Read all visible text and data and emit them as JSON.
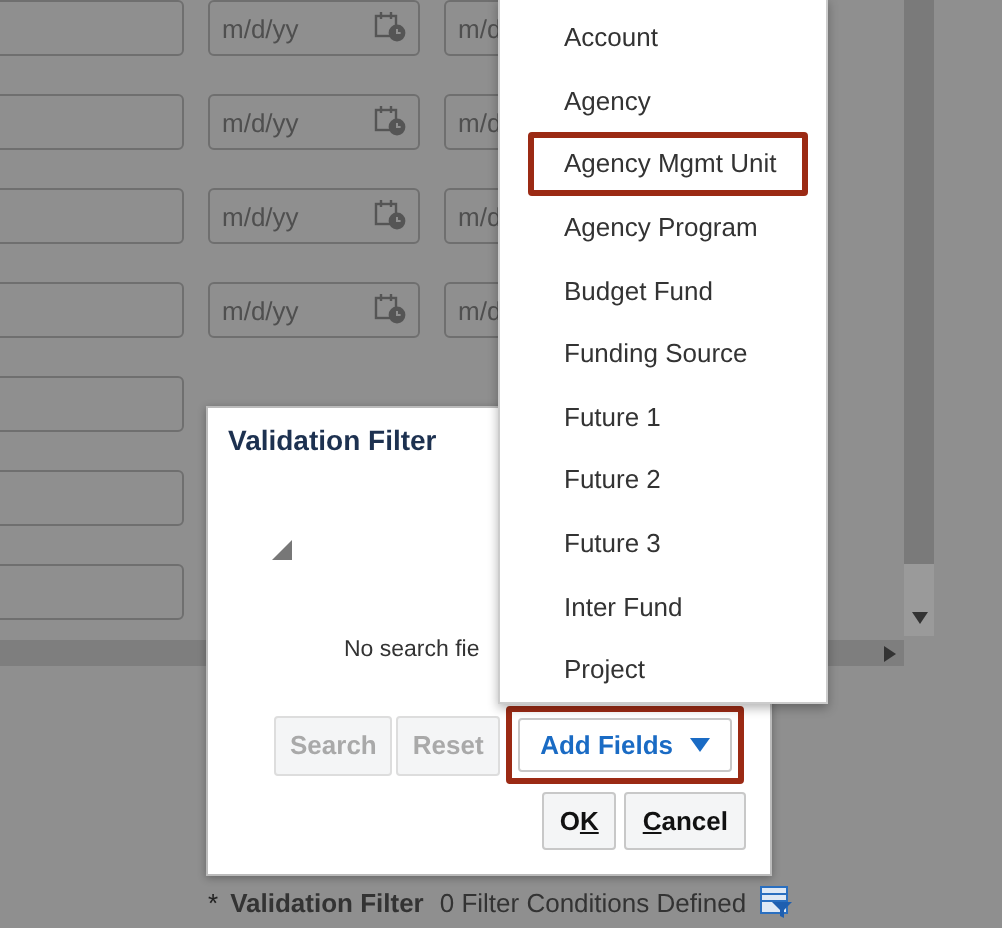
{
  "form": {
    "rows": [
      {
        "kind": "dates",
        "date_values": [
          "m/d/yy",
          "m/d"
        ]
      },
      {
        "kind": "dates",
        "date_values": [
          "m/d/yy",
          "m/d"
        ]
      },
      {
        "kind": "dates",
        "date_values": [
          "m/d/yy",
          "m/d"
        ]
      },
      {
        "kind": "dates",
        "date_values": [
          "m/d/yy",
          "m/d"
        ]
      },
      {
        "kind": "plain"
      },
      {
        "kind": "plain"
      },
      {
        "kind": "plain"
      }
    ],
    "footer": {
      "required_marker": "*",
      "label": "Validation Filter",
      "value": "0 Filter Conditions Defined"
    }
  },
  "dialog": {
    "title": "Validation Filter",
    "message": "No search fie",
    "buttons": [
      {
        "label": "Search",
        "kind": "plain",
        "disabled": true,
        "highlighted": false
      },
      {
        "label": "Reset",
        "kind": "plain",
        "disabled": true,
        "highlighted": false
      },
      {
        "label": "Add Fields",
        "kind": "menu",
        "disabled": false,
        "highlighted": true
      }
    ],
    "actions": [
      {
        "label_parts": [
          {
            "text": "O",
            "underlined": false
          },
          {
            "text": "K",
            "underlined": true
          }
        ]
      },
      {
        "label_parts": [
          {
            "text": "C",
            "underlined": true
          },
          {
            "text": "ancel",
            "underlined": false
          }
        ]
      }
    ]
  },
  "menu": {
    "items": [
      {
        "label": "Account",
        "highlighted": false
      },
      {
        "label": "Agency",
        "highlighted": false
      },
      {
        "label": "Agency Mgmt Unit",
        "highlighted": true
      },
      {
        "label": "Agency Program",
        "highlighted": false
      },
      {
        "label": "Budget Fund",
        "highlighted": false
      },
      {
        "label": "Funding Source",
        "highlighted": false
      },
      {
        "label": "Future 1",
        "highlighted": false
      },
      {
        "label": "Future 2",
        "highlighted": false
      },
      {
        "label": "Future 3",
        "highlighted": false
      },
      {
        "label": "Inter Fund",
        "highlighted": false
      },
      {
        "label": "Project",
        "highlighted": false
      }
    ]
  }
}
